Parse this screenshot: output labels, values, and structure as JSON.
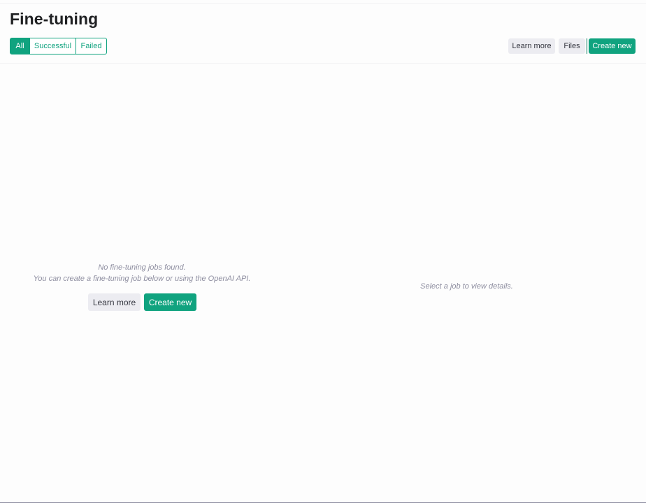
{
  "page": {
    "title": "Fine-tuning"
  },
  "filters": {
    "items": [
      {
        "label": "All",
        "active": true
      },
      {
        "label": "Successful",
        "active": false
      },
      {
        "label": "Failed",
        "active": false
      }
    ]
  },
  "toolbar": {
    "learn_more_label": "Learn more",
    "files_label": "Files",
    "create_new_label": "Create new"
  },
  "jobs_panel": {
    "empty_title": "No fine-tuning jobs found.",
    "empty_hint": "You can create a fine-tuning job below or using the OpenAI API.",
    "learn_more_label": "Learn more",
    "create_new_label": "Create new"
  },
  "details_panel": {
    "placeholder": "Select a job to view details."
  },
  "colors": {
    "accent": "#10a37f",
    "muted_text": "#8e8ea0",
    "secondary_button": "#ececf1"
  }
}
